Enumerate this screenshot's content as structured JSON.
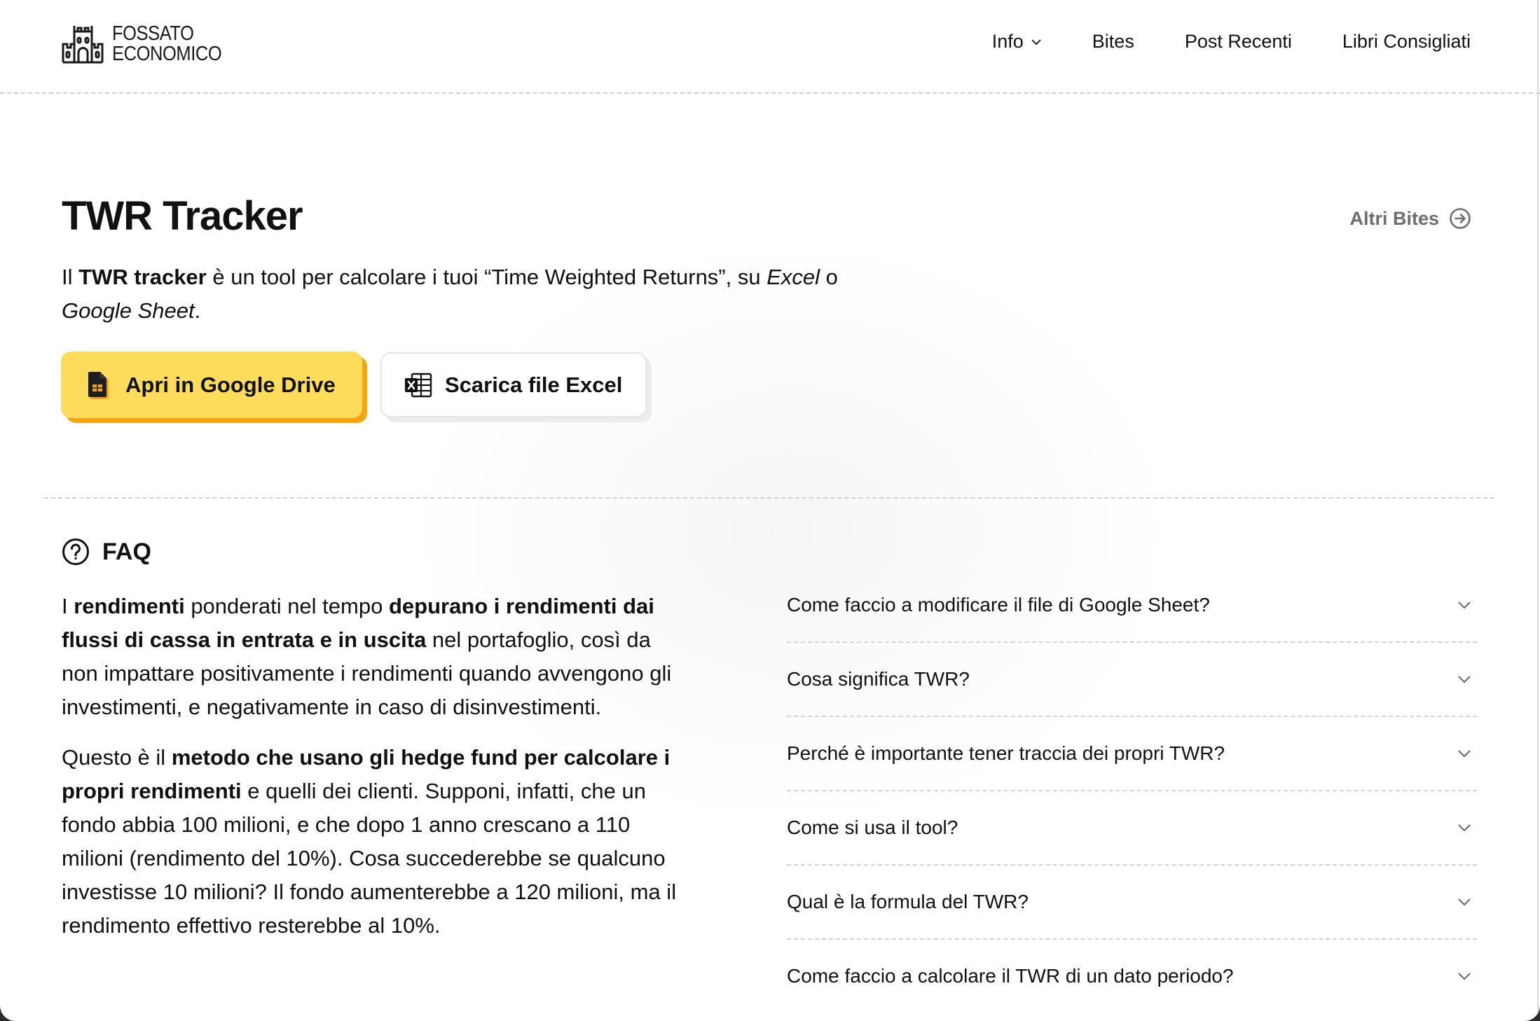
{
  "brand": {
    "line1": "FOSSATO",
    "line2": "ECONOMICO",
    "icon": "castle-icon"
  },
  "nav": {
    "items": [
      {
        "label": "Info",
        "has_dropdown": true
      },
      {
        "label": "Bites"
      },
      {
        "label": "Post Recenti"
      },
      {
        "label": "Libri Consigliati"
      }
    ]
  },
  "hero": {
    "title": "TWR Tracker",
    "altri_label": "Altri Bites",
    "altri_icon": "arrow-circle-right-icon",
    "intro": {
      "pre": "Il ",
      "bold": "TWR tracker",
      "mid": " è un tool per calcolare i tuoi “Time Weighted Returns”, su ",
      "italic1": "Excel",
      "conj": " o ",
      "italic2": "Google Sheet",
      "end": "."
    },
    "buttons": {
      "drive": {
        "label": "Apri in Google Drive",
        "icon": "google-sheets-icon",
        "color": "#fddb5b",
        "shadow": "#f6a512"
      },
      "excel": {
        "label": "Scarica file Excel",
        "icon": "excel-icon"
      }
    }
  },
  "faq": {
    "heading": "FAQ",
    "icon": "question-circle-icon",
    "paragraphs": [
      [
        {
          "t": "I ",
          "b": false
        },
        {
          "t": "rendimenti",
          "b": true
        },
        {
          "t": " ponderati nel tempo ",
          "b": false
        },
        {
          "t": "depurano i rendimenti dai flussi di cassa in entrata e in uscita",
          "b": true
        },
        {
          "t": " nel portafoglio, così da non impattare positivamente i rendimenti quando avvengono gli investimenti, e negativamente in caso di disinvestimenti.",
          "b": false
        }
      ],
      [
        {
          "t": "Questo è il ",
          "b": false
        },
        {
          "t": "metodo che usano gli hedge fund per calcolare i propri rendimenti",
          "b": true
        },
        {
          "t": " e quelli dei clienti. Supponi, infatti, che un fondo abbia 100 milioni, e che dopo 1 anno crescano a 110 milioni (rendimento del 10%). Cosa succederebbe se qualcuno investisse 10 milioni? Il fondo aumenterebbe a 120 milioni, ma il rendimento effettivo resterebbe al 10%.",
          "b": false
        }
      ]
    ],
    "questions": [
      "Come faccio a modificare il file di Google Sheet?",
      "Cosa significa TWR?",
      "Perché è importante tener traccia dei propri TWR?",
      "Come si usa il tool?",
      "Qual è la formula del TWR?",
      "Come faccio a calcolare il TWR di un dato periodo?"
    ]
  }
}
